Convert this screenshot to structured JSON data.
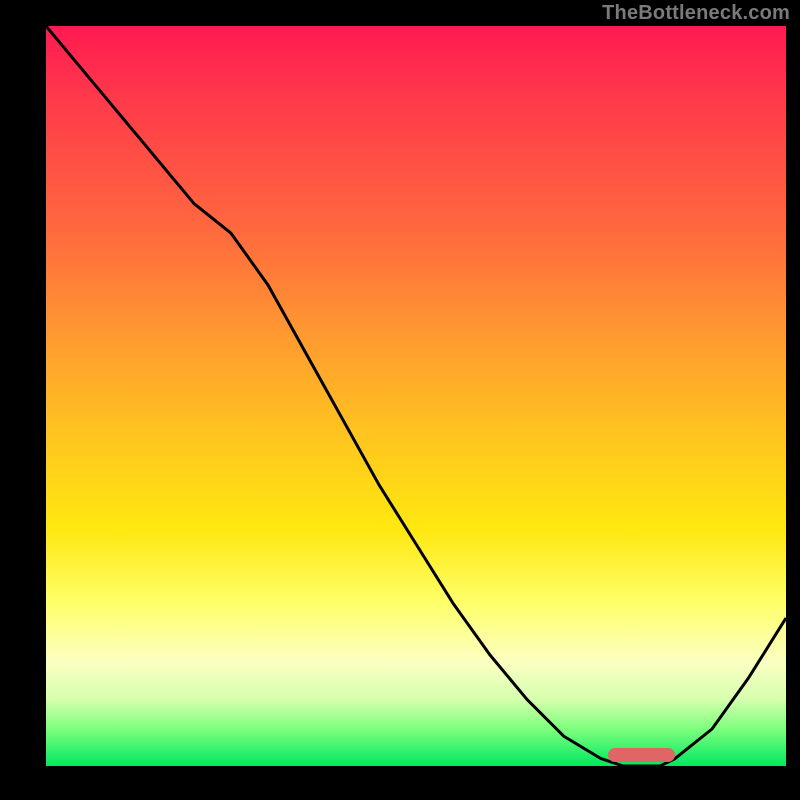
{
  "watermark": "TheBottleneck.com",
  "chart_data": {
    "type": "line",
    "title": "",
    "xlabel": "",
    "ylabel": "",
    "x": [
      0,
      5,
      10,
      15,
      20,
      25,
      30,
      35,
      40,
      45,
      50,
      55,
      60,
      65,
      70,
      75,
      78,
      80,
      83,
      85,
      90,
      95,
      100
    ],
    "values": [
      100,
      94,
      88,
      82,
      76,
      72,
      65,
      56,
      47,
      38,
      30,
      22,
      15,
      9,
      4,
      1,
      0,
      0,
      0,
      1,
      5,
      12,
      20
    ],
    "xlim": [
      0,
      100
    ],
    "ylim": [
      0,
      100
    ],
    "background_gradient": {
      "direction": "vertical",
      "stops": [
        {
          "pos": 0.0,
          "color": "#ff1a52"
        },
        {
          "pos": 0.1,
          "color": "#ff3a4a"
        },
        {
          "pos": 0.28,
          "color": "#ff6a3e"
        },
        {
          "pos": 0.42,
          "color": "#ff9a30"
        },
        {
          "pos": 0.56,
          "color": "#ffc71e"
        },
        {
          "pos": 0.68,
          "color": "#ffe810"
        },
        {
          "pos": 0.78,
          "color": "#feff6a"
        },
        {
          "pos": 0.86,
          "color": "#fbffc2"
        },
        {
          "pos": 0.91,
          "color": "#d5ffad"
        },
        {
          "pos": 0.95,
          "color": "#7dff7d"
        },
        {
          "pos": 1.0,
          "color": "#00e861"
        }
      ]
    },
    "highlight_range": {
      "x_start": 76,
      "x_end": 85,
      "color": "#e06666"
    }
  }
}
